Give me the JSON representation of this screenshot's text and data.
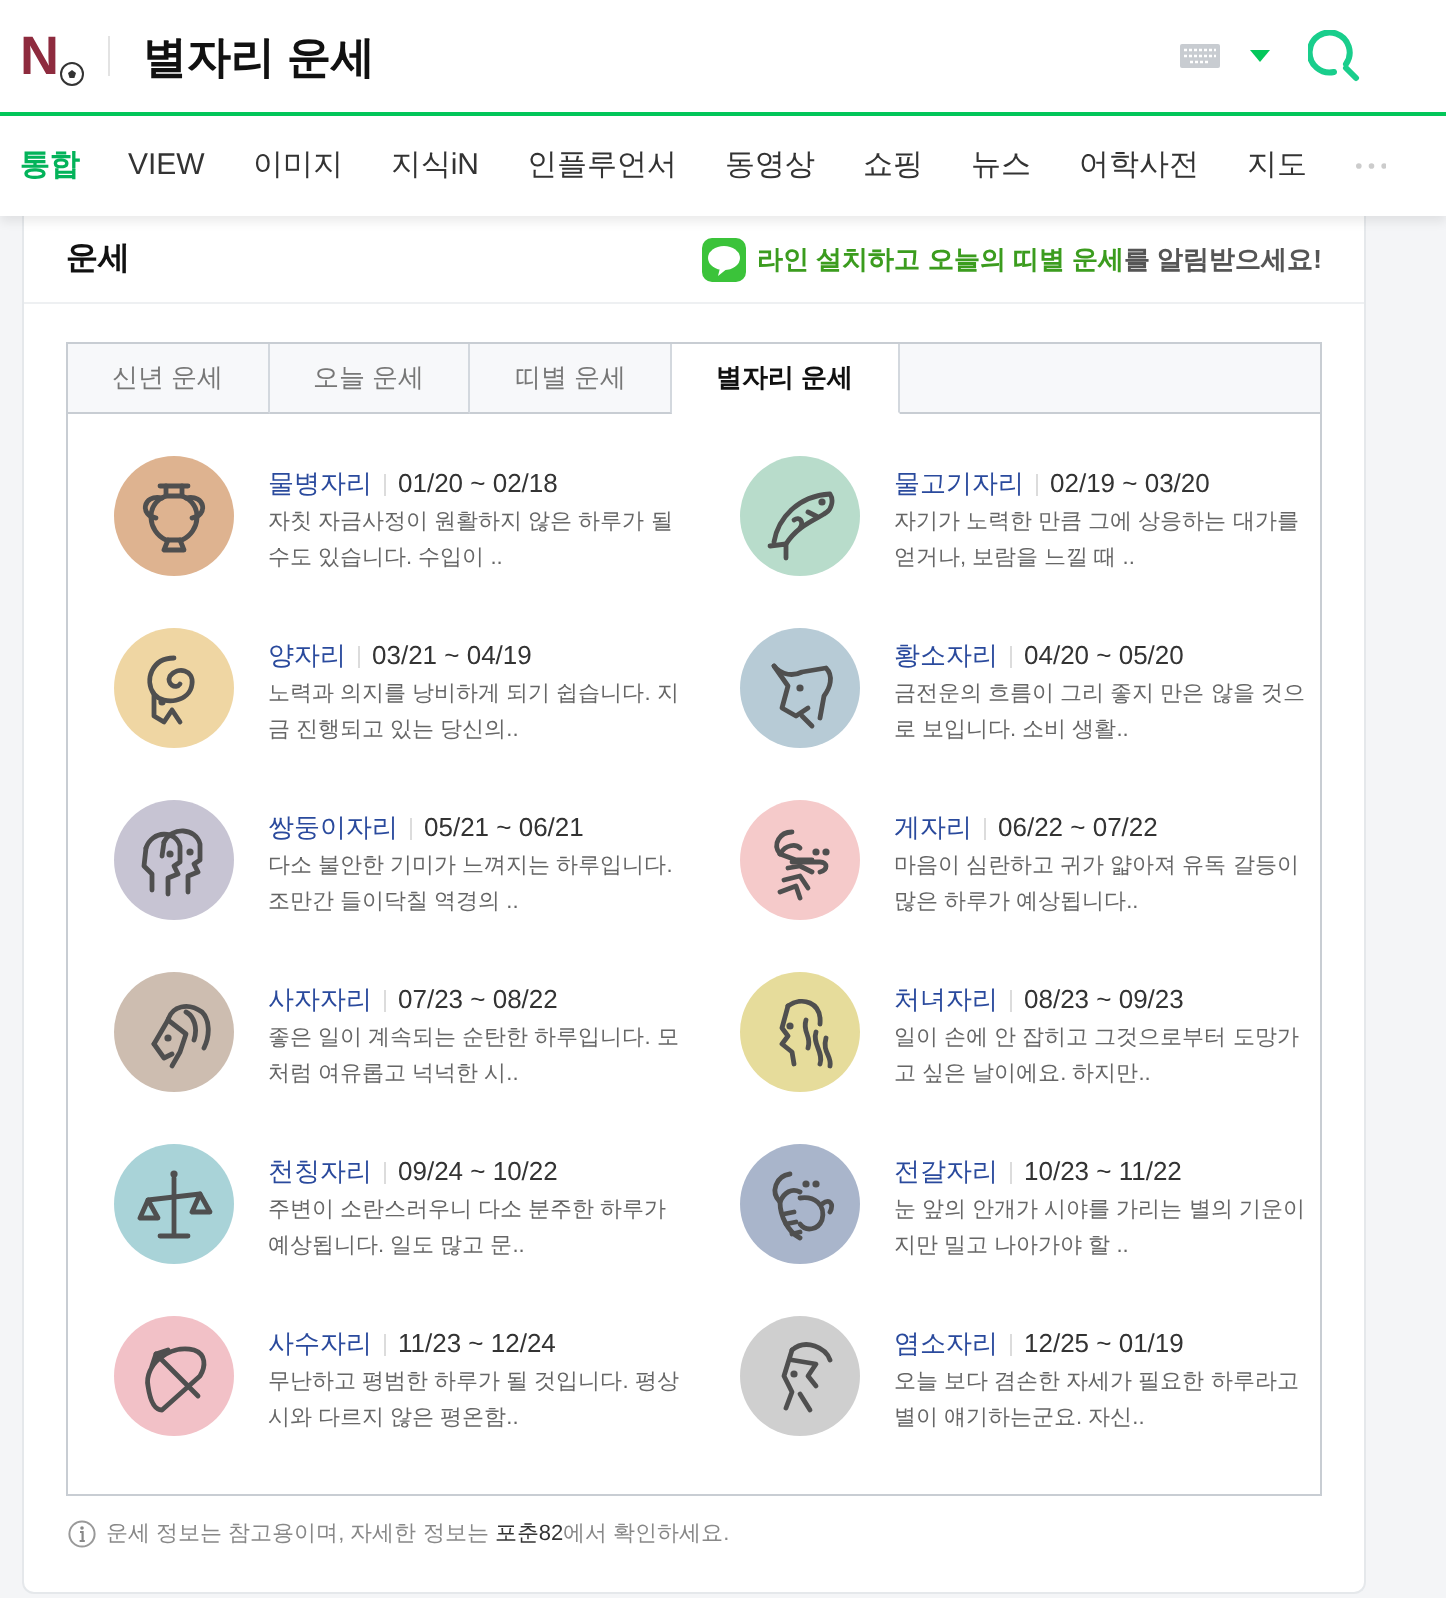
{
  "header": {
    "logo_text": "N",
    "title": "별자리 운세"
  },
  "nav": [
    {
      "label": "통합",
      "selected": true
    },
    {
      "label": "VIEW",
      "selected": false
    },
    {
      "label": "이미지",
      "selected": false
    },
    {
      "label": "지식iN",
      "selected": false
    },
    {
      "label": "인플루언서",
      "selected": false
    },
    {
      "label": "동영상",
      "selected": false
    },
    {
      "label": "쇼핑",
      "selected": false
    },
    {
      "label": "뉴스",
      "selected": false
    },
    {
      "label": "어학사전",
      "selected": false
    },
    {
      "label": "지도",
      "selected": false
    }
  ],
  "card": {
    "title": "운세",
    "promo": {
      "highlight": "라인 설치하고 오늘의 띠별 운세",
      "rest": "를 알림받으세요!"
    }
  },
  "tabs": [
    {
      "label": "신년 운세",
      "selected": false
    },
    {
      "label": "오늘 운세",
      "selected": false
    },
    {
      "label": "띠별 운세",
      "selected": false
    },
    {
      "label": "별자리 운세",
      "selected": true
    }
  ],
  "signs": [
    {
      "kind": "aquarius",
      "name": "물병자리",
      "dates": "01/20 ~ 02/18",
      "summary": "자칫 자금사정이 원활하지 않은 하루가 될 수도 있습니다. 수입이 ..",
      "color": "#deb390"
    },
    {
      "kind": "pisces",
      "name": "물고기자리",
      "dates": "02/19 ~ 03/20",
      "summary": "자기가 노력한 만큼 그에 상응하는 대가를 얻거나, 보람을 느낄 때 ..",
      "color": "#b8dccb"
    },
    {
      "kind": "aries",
      "name": "양자리",
      "dates": "03/21 ~ 04/19",
      "summary": "노력과 의지를 낭비하게 되기 쉽습니다. 지금 진행되고 있는 당신의..",
      "color": "#efd6a3"
    },
    {
      "kind": "taurus",
      "name": "황소자리",
      "dates": "04/20 ~ 05/20",
      "summary": "금전운의 흐름이 그리 좋지 만은 않을 것으로 보입니다. 소비 생활..",
      "color": "#b7cbd6"
    },
    {
      "kind": "gemini",
      "name": "쌍둥이자리",
      "dates": "05/21 ~ 06/21",
      "summary": "다소 불안한 기미가 느껴지는 하루입니다. 조만간 들이닥칠 역경의 ..",
      "color": "#c7c4d3"
    },
    {
      "kind": "cancer",
      "name": "게자리",
      "dates": "06/22 ~ 07/22",
      "summary": "마음이 심란하고 귀가 얇아져 유독 갈등이 많은 하루가 예상됩니다..",
      "color": "#f5caca"
    },
    {
      "kind": "leo",
      "name": "사자자리",
      "dates": "07/23 ~ 08/22",
      "summary": "좋은 일이 계속되는 순탄한 하루입니다. 모처럼 여유롭고 넉넉한 시..",
      "color": "#cdbdb0"
    },
    {
      "kind": "virgo",
      "name": "처녀자리",
      "dates": "08/23 ~ 09/23",
      "summary": "일이 손에 안 잡히고 그것으로부터 도망가고 싶은 날이에요. 하지만..",
      "color": "#e6dc9b"
    },
    {
      "kind": "libra",
      "name": "천칭자리",
      "dates": "09/24 ~ 10/22",
      "summary": "주변이 소란스러우니 다소 분주한 하루가 예상됩니다. 일도 많고 문..",
      "color": "#a9d3d8"
    },
    {
      "kind": "scorpio",
      "name": "전갈자리",
      "dates": "10/23 ~ 11/22",
      "summary": "눈 앞의 안개가 시야를 가리는 별의 기운이지만 밀고 나아가야 할 ..",
      "color": "#a9b5cb"
    },
    {
      "kind": "sagittarius",
      "name": "사수자리",
      "dates": "11/23 ~ 12/24",
      "summary": "무난하고 평범한 하루가 될 것입니다. 평상시와 다르지 않은 평온함..",
      "color": "#f2c1c7"
    },
    {
      "kind": "capricorn",
      "name": "염소자리",
      "dates": "12/25 ~ 01/19",
      "summary": "오늘 보다 겸손한 자세가 필요한 하루라고 별이 얘기하는군요. 자신..",
      "color": "#cfcfcf"
    }
  ],
  "footer": {
    "before": "운세 정보는 참고용이며, 자세한 정보는 ",
    "link": "포춘82",
    "after": "에서 확인하세요."
  }
}
